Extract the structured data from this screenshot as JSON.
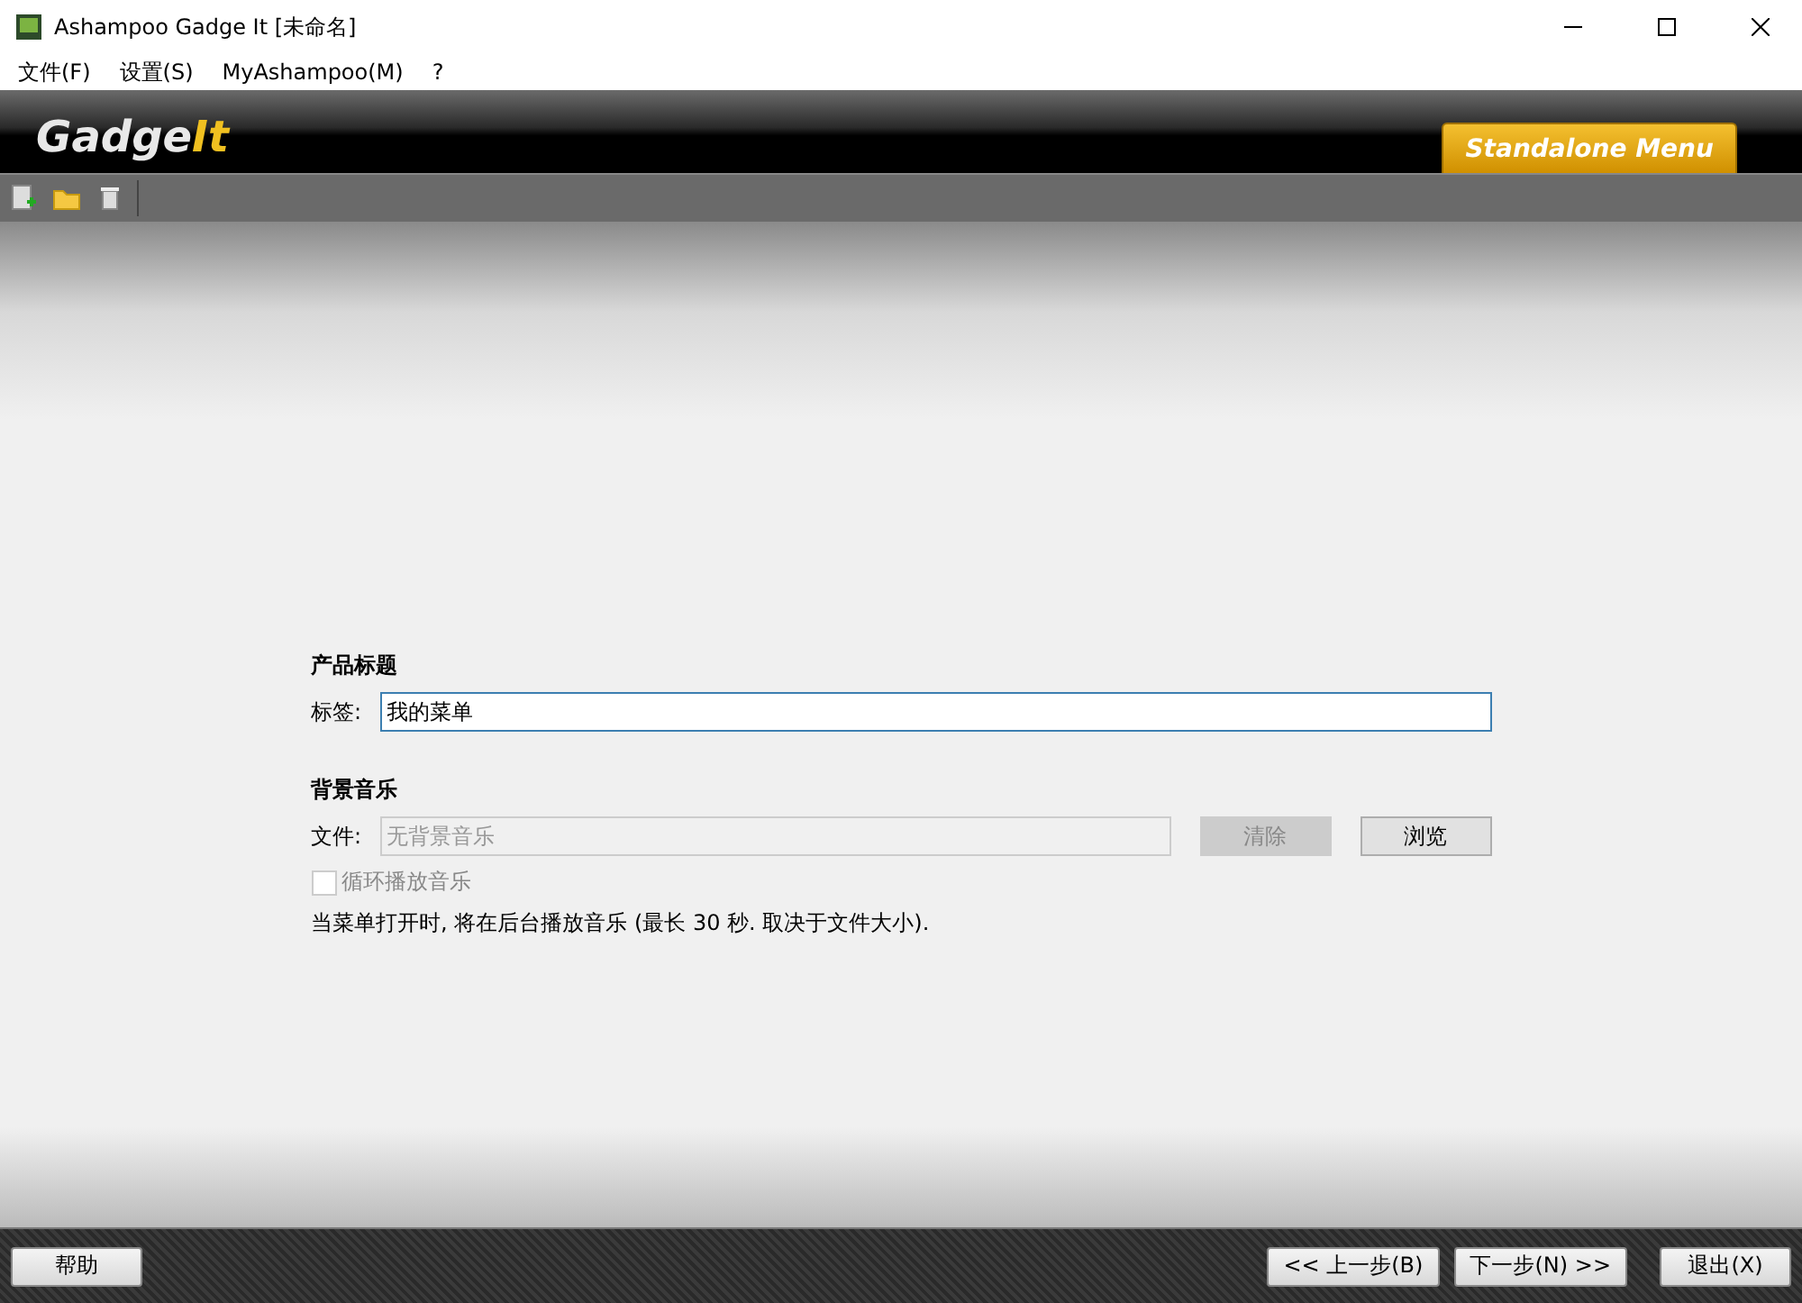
{
  "window": {
    "title": "Ashampoo Gadge It [未命名]"
  },
  "menu": [
    "文件(F)",
    "设置(S)",
    "MyAshampoo(M)",
    "?"
  ],
  "logo": {
    "word": "Gadge",
    "accent": "It"
  },
  "mode_tab": {
    "label": "Standalone Menu",
    "selected": true
  },
  "sections": [
    {
      "kind": "title",
      "heading": "产品标题",
      "label": "标签:",
      "value": "我的菜单"
    },
    {
      "kind": "music",
      "heading": "背景音乐",
      "label": "文件:",
      "placeholder": "无背景音乐",
      "clear": {
        "label": "清除",
        "disabled": true
      },
      "browse": {
        "label": "浏览",
        "disabled": false
      },
      "loop": {
        "label": "循环播放音乐",
        "checked": false,
        "disabled": true
      },
      "note": "当菜单打开时, 将在后台播放音乐 (最长 30 秒. 取决于文件大小)."
    }
  ],
  "footer": {
    "help": "帮助",
    "back": "<< 上一步(B)",
    "next": "下一步(N) >>",
    "exit": "退出(X)"
  }
}
